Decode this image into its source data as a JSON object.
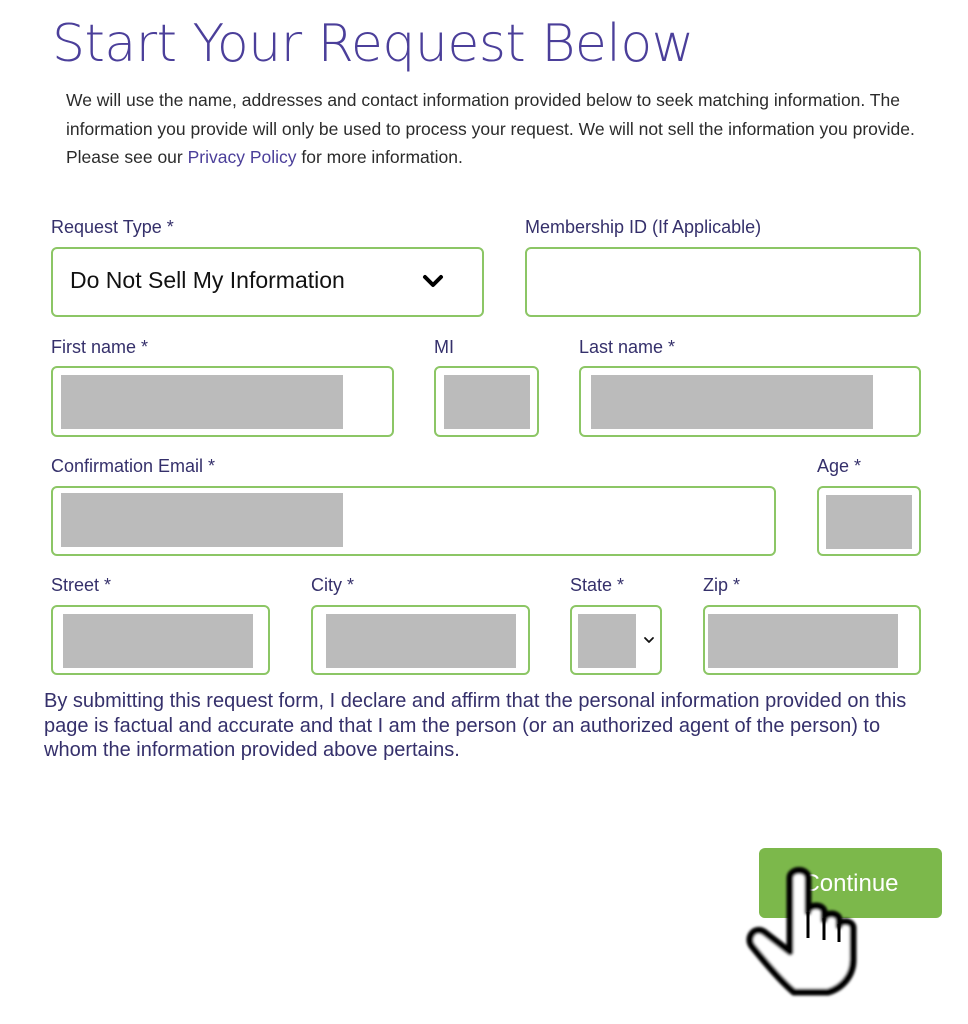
{
  "page": {
    "title": "Start Your Request Below",
    "intro": {
      "text_before_link": "We will use the name, addresses and contact information provided below to seek matching information. The information you provide will only be used to process your request. We will not sell the information you provide. Please see our ",
      "link_text": "Privacy Policy",
      "text_after_link": " for more information."
    }
  },
  "form": {
    "request_type": {
      "label": "Request Type *",
      "selected_value": "Do Not Sell My Information",
      "icon": "chevron-down-icon"
    },
    "membership_id": {
      "label": "Membership ID (If Applicable)",
      "value": ""
    },
    "first_name": {
      "label": "First name *",
      "value": "[redacted]"
    },
    "middle_initial": {
      "label": "MI",
      "value": "[redacted]"
    },
    "last_name": {
      "label": "Last name *",
      "value": "[redacted]"
    },
    "confirmation_email": {
      "label": "Confirmation Email *",
      "value": "[redacted]"
    },
    "age": {
      "label": "Age *",
      "value": "[redacted]"
    },
    "street": {
      "label": "Street *",
      "value": "[redacted]"
    },
    "city": {
      "label": "City *",
      "value": "[redacted]"
    },
    "state": {
      "label": "State *",
      "selected_value": "[redacted]",
      "icon": "chevron-down-icon"
    },
    "zip": {
      "label": "Zip *",
      "value": "[redacted]"
    }
  },
  "declaration": "By submitting this request form, I declare and affirm that the personal information provided on this page is factual and accurate and that I am the person (or an authorized agent of the person) to whom the information provided above pertains.",
  "actions": {
    "continue_label": "Continue",
    "cursor_icon": "pointer-hand-icon"
  },
  "colors": {
    "brand_purple": "#4b3f9a",
    "label_text": "#35306b",
    "field_border": "#8cc665",
    "button_green": "#7cb84b",
    "redaction_gray": "#bbbbbb"
  }
}
